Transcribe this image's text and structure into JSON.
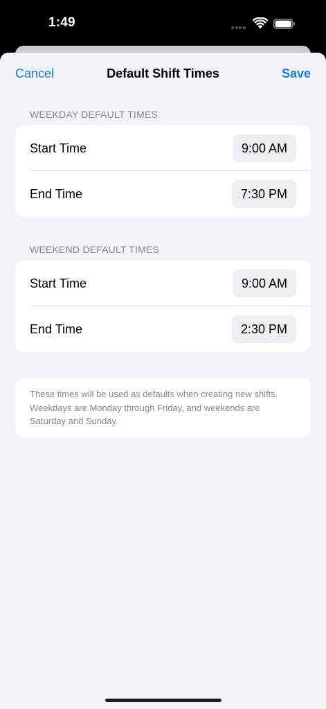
{
  "status_bar": {
    "time": "1:49"
  },
  "nav": {
    "cancel_label": "Cancel",
    "title": "Default Shift Times",
    "save_label": "Save"
  },
  "weekday": {
    "header": "WEEKDAY DEFAULT TIMES",
    "rows": [
      {
        "label": "Start Time",
        "value": "9:00 AM"
      },
      {
        "label": "End Time",
        "value": "7:30 PM"
      }
    ]
  },
  "weekend": {
    "header": "WEEKEND DEFAULT TIMES",
    "rows": [
      {
        "label": "Start Time",
        "value": "9:00 AM"
      },
      {
        "label": "End Time",
        "value": "2:30 PM"
      }
    ]
  },
  "note": {
    "text": "These times will be used as defaults when creating new shifts. Weekdays are Monday through Friday, and weekends are Saturday and Sunday."
  },
  "colors": {
    "accent": "#1a7fd0",
    "background": "#f2f2f7",
    "card": "#ffffff",
    "secondary_text": "#86868b"
  },
  "icons": [
    "wifi-icon",
    "battery-icon",
    "signal-dots-icon"
  ]
}
